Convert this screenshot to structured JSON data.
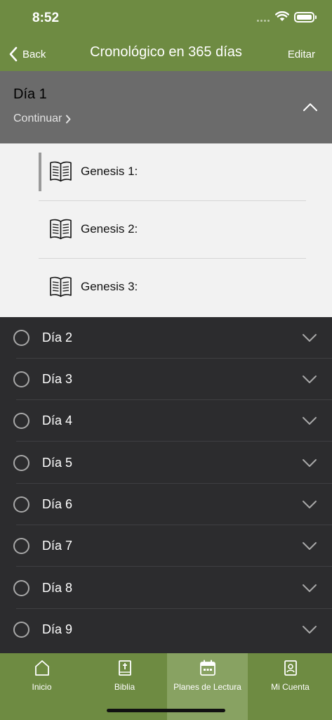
{
  "status_bar": {
    "time": "8:52"
  },
  "nav": {
    "back_label": "Back",
    "title": "Cronológico en 365 días",
    "edit_label": "Editar"
  },
  "expanded_day": {
    "title": "Día 1",
    "continue_label": "Continuar",
    "readings": [
      {
        "label": "Genesis 1:",
        "current": true
      },
      {
        "label": "Genesis 2:",
        "current": false
      },
      {
        "label": "Genesis 3:",
        "current": false
      }
    ]
  },
  "days": [
    {
      "label": "Día 2"
    },
    {
      "label": "Día 3"
    },
    {
      "label": "Día 4"
    },
    {
      "label": "Día 5"
    },
    {
      "label": "Día 6"
    },
    {
      "label": "Día 7"
    },
    {
      "label": "Día 8"
    },
    {
      "label": "Día 9"
    }
  ],
  "tabs": [
    {
      "label": "Inicio",
      "icon": "home-icon"
    },
    {
      "label": "Biblia",
      "icon": "bible-icon"
    },
    {
      "label": "Planes de Lectura",
      "icon": "calendar-icon",
      "active": true
    },
    {
      "label": "Mi Cuenta",
      "icon": "account-icon"
    }
  ],
  "colors": {
    "header_green": "#6e8b42",
    "active_tab": "#88a262",
    "day_header": "#6b6b6b",
    "list_bg": "#2c2c2e",
    "readings_bg": "#f2f2f2"
  }
}
